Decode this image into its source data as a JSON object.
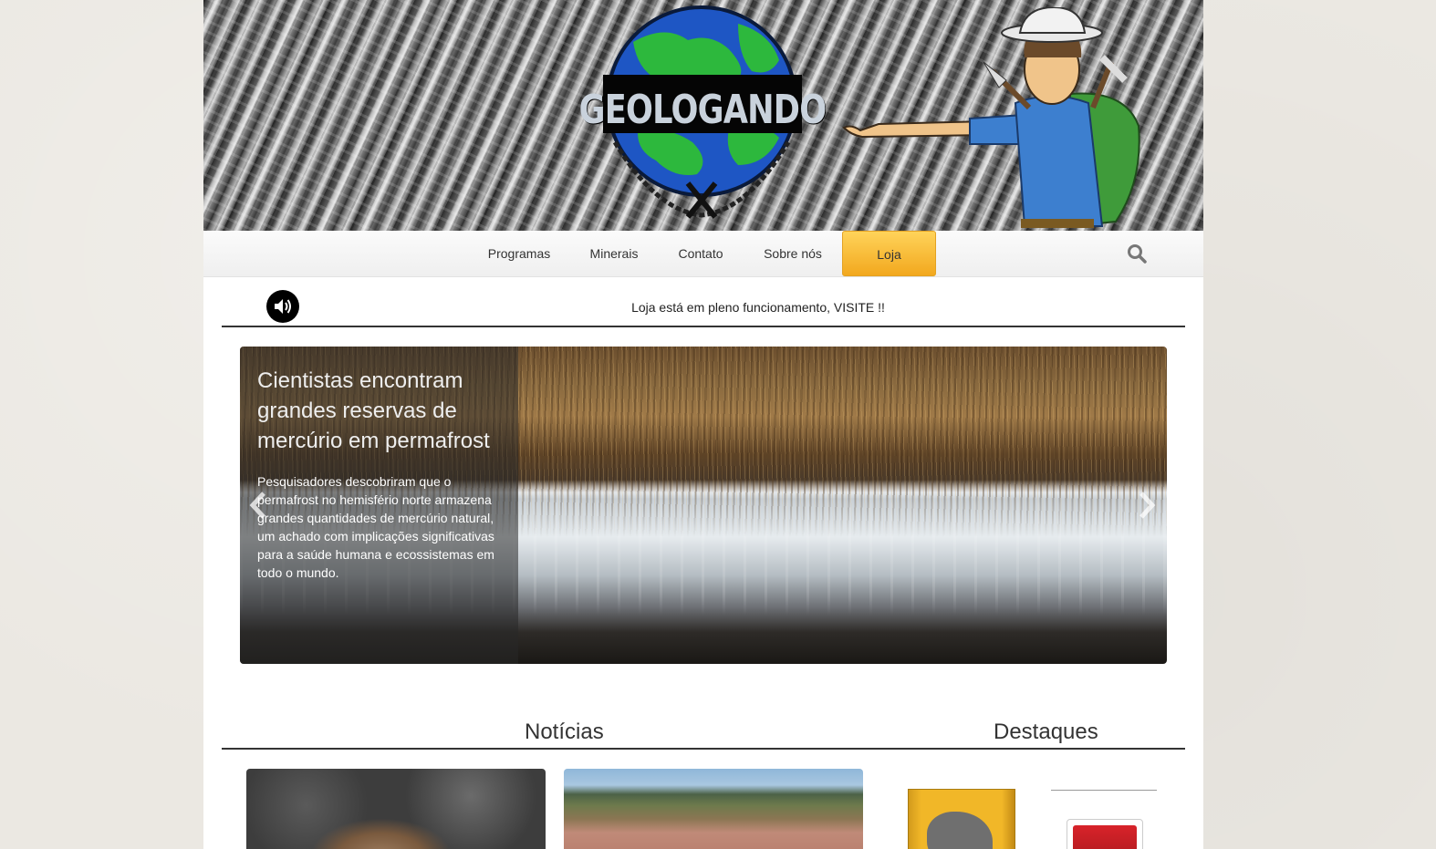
{
  "site": {
    "logo_text": "GEOLOGANDO"
  },
  "nav": {
    "items": [
      "Programas",
      "Minerais",
      "Contato",
      "Sobre nós",
      "Loja"
    ],
    "active": "Loja",
    "search_icon": "search-icon",
    "accent_color": "#f5b731"
  },
  "announcement": {
    "sound_icon": "speaker-icon",
    "text": "Loja está em pleno funcionamento, VISITE !!"
  },
  "carousel": {
    "title": "Cientistas encontram grandes reservas de mercúrio em permafrost",
    "body": "Pesquisadores descobriram que o permafrost no hemisfério norte armazena grandes quantidades de mercúrio natural, um achado com implicações significativas para a saúde humana e ecossistemas em todo o mundo.",
    "prev_icon": "chevron-left-icon",
    "next_icon": "chevron-right-icon"
  },
  "sections": {
    "news": "Notícias",
    "featured": "Destaques"
  }
}
